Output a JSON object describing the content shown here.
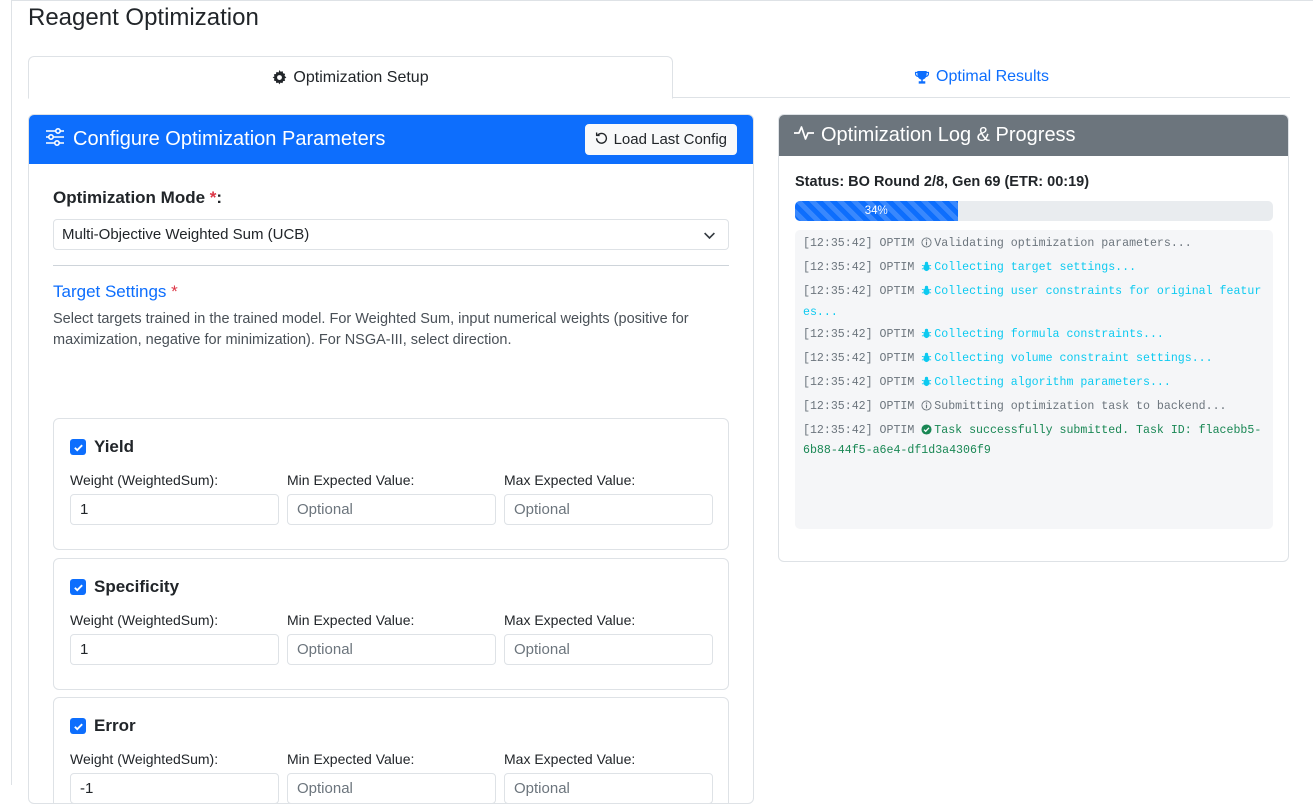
{
  "page": {
    "title": "Reagent Optimization"
  },
  "tabs": [
    {
      "label": "Optimization Setup",
      "icon": "gear-icon",
      "active": true
    },
    {
      "label": "Optimal Results",
      "icon": "trophy-icon",
      "active": false
    }
  ],
  "config": {
    "header_title": "Configure Optimization Parameters",
    "load_button": "Load Last Config",
    "mode_label": "Optimization Mode",
    "required_mark": "*",
    "mode_colon": ":",
    "mode_value": "Multi-Objective Weighted Sum (UCB)",
    "target_heading": "Target Settings",
    "target_desc": "Select targets trained in the trained model. For Weighted Sum, input numerical weights (positive for maximization, negative for minimization). For NSGA-III, select direction.",
    "targets": [
      {
        "name": "Yield",
        "checked": true,
        "weight_label": "Weight (WeightedSum):",
        "weight": "1",
        "min_label": "Min Expected Value:",
        "min_placeholder": "Optional",
        "max_label": "Max Expected Value:",
        "max_placeholder": "Optional"
      },
      {
        "name": "Specificity",
        "checked": true,
        "weight_label": "Weight (WeightedSum):",
        "weight": "1",
        "min_label": "Min Expected Value:",
        "min_placeholder": "Optional",
        "max_label": "Max Expected Value:",
        "max_placeholder": "Optional"
      },
      {
        "name": "Error",
        "checked": true,
        "weight_label": "Weight (WeightedSum):",
        "weight": "-1",
        "min_label": "Min Expected Value:",
        "min_placeholder": "Optional",
        "max_label": "Max Expected Value:",
        "max_placeholder": "Optional"
      }
    ]
  },
  "log": {
    "header_title": "Optimization Log & Progress",
    "status": "Status: BO Round 2/8, Gen 69 (ETR: 00:19)",
    "progress_percent": 34,
    "progress_label": "34%",
    "colors": {
      "info": "#6c757d",
      "debug": "#0dcaf0",
      "success": "#198754"
    },
    "lines": [
      {
        "ts": "[12:35:42] OPTIM",
        "level": "info",
        "icon": "info-circle-icon",
        "text": "Validating optimization parameters..."
      },
      {
        "ts": "[12:35:42] OPTIM",
        "level": "debug",
        "icon": "bug-icon",
        "text": "Collecting target settings..."
      },
      {
        "ts": "[12:35:42] OPTIM",
        "level": "debug",
        "icon": "bug-icon",
        "text": "Collecting user constraints for original features..."
      },
      {
        "ts": "[12:35:42] OPTIM",
        "level": "debug",
        "icon": "bug-icon",
        "text": "Collecting formula constraints..."
      },
      {
        "ts": "[12:35:42] OPTIM",
        "level": "debug",
        "icon": "bug-icon",
        "text": "Collecting volume constraint settings..."
      },
      {
        "ts": "[12:35:42] OPTIM",
        "level": "debug",
        "icon": "bug-icon",
        "text": "Collecting algorithm parameters..."
      },
      {
        "ts": "[12:35:42] OPTIM",
        "level": "info",
        "icon": "info-circle-icon",
        "text": "Submitting optimization task to backend..."
      },
      {
        "ts": "[12:35:42] OPTIM",
        "level": "success",
        "icon": "check-circle-icon",
        "text": "Task successfully submitted. Task ID: flacebb5-6b88-44f5-a6e4-df1d3a4306f9"
      }
    ]
  }
}
